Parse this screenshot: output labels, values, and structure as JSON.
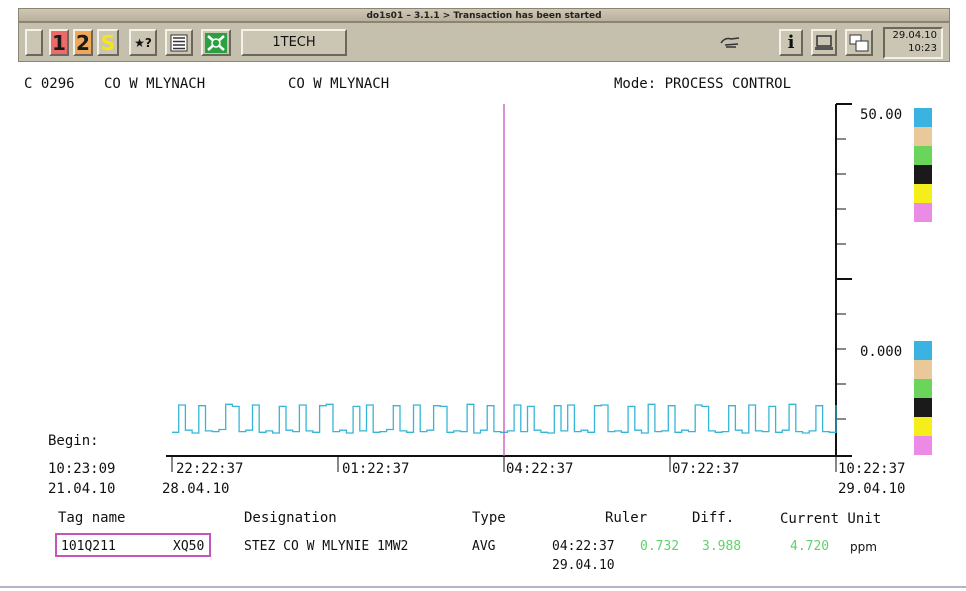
{
  "window": {
    "title": "do1s01 – 3.1.1 > Transaction has been started"
  },
  "toolbar": {
    "btn1": "1",
    "btn2": "2",
    "btnS": "S",
    "btnHelp": "★?",
    "tech_label": "1TECH",
    "info_label": "i",
    "date": "29.04.10",
    "time": "10:23"
  },
  "header": {
    "code": "C 0296",
    "name1": "CO W MLYNACH",
    "name2": "CO W MLYNACH",
    "mode": "Mode: PROCESS CONTROL"
  },
  "begin": {
    "label": "Begin:",
    "time": "10:23:09",
    "date": "21.04.10"
  },
  "chart_data": {
    "type": "line",
    "ylim": [
      0.0,
      50.0
    ],
    "y_labels": [
      "50.00",
      "0.000"
    ],
    "x_ticks": [
      {
        "time": "22:22:37",
        "date": "28.04.10"
      },
      {
        "time": "01:22:37",
        "date": ""
      },
      {
        "time": "04:22:37",
        "date": ""
      },
      {
        "time": "07:22:37",
        "date": ""
      },
      {
        "time": "10:22:37",
        "date": "29.04.10"
      }
    ],
    "ruler_position": "04:22:37",
    "series_color": "#35b6d6",
    "ruler_color": "#c455c0",
    "swatch_colors": [
      "#3bb3e0",
      "#e9c99a",
      "#6ad55a",
      "#1a1a1a",
      "#f5ee1a",
      "#ec8be6"
    ],
    "series": [
      {
        "values": [
          3.1,
          7.0,
          3.4,
          3.0,
          6.9,
          3.3,
          3.2,
          3.5,
          7.1,
          6.8,
          3.2,
          3.4,
          7.0,
          3.1,
          3.3,
          3.0,
          6.8,
          3.4,
          3.2,
          7.0,
          3.3,
          3.1,
          6.9,
          7.1,
          3.2,
          3.4,
          3.0,
          6.8,
          3.3,
          7.0,
          3.1,
          3.2,
          3.5,
          6.9,
          3.3,
          3.1,
          7.0,
          3.2,
          3.4,
          6.9,
          6.8,
          3.1,
          3.3,
          3.2,
          7.1,
          3.0,
          3.4,
          6.9,
          3.2,
          3.1,
          3.3,
          7.0,
          3.2,
          6.8,
          3.4,
          3.1,
          3.0,
          6.9,
          3.3,
          7.0,
          3.2,
          3.4,
          3.1,
          6.9,
          7.0,
          3.2,
          3.3,
          3.1,
          6.8,
          3.4,
          3.0,
          7.1,
          3.2,
          3.3,
          6.9,
          3.1,
          3.4,
          3.2,
          7.0,
          6.8,
          3.3,
          3.1,
          3.2,
          6.9,
          3.4,
          3.0,
          7.0,
          3.3,
          3.2,
          6.8,
          3.1,
          3.4,
          7.1,
          3.2,
          3.0,
          3.3,
          6.9,
          3.2,
          3.1,
          7.0
        ]
      }
    ]
  },
  "footer": {
    "headers": {
      "tag": "Tag name",
      "designation": "Designation",
      "type": "Type",
      "ruler": "Ruler",
      "diff": "Diff.",
      "current_unit": "Current Unit"
    },
    "row": {
      "tag": "101Q211",
      "tag_code": "XQ50",
      "designation": "STEZ CO W MLYNIE 1MW2",
      "type": "AVG",
      "ruler_time": "04:22:37",
      "ruler_date": "29.04.10",
      "ruler_value": "0.732",
      "diff": "3.988",
      "current": "4.720",
      "unit": "ppm"
    }
  }
}
